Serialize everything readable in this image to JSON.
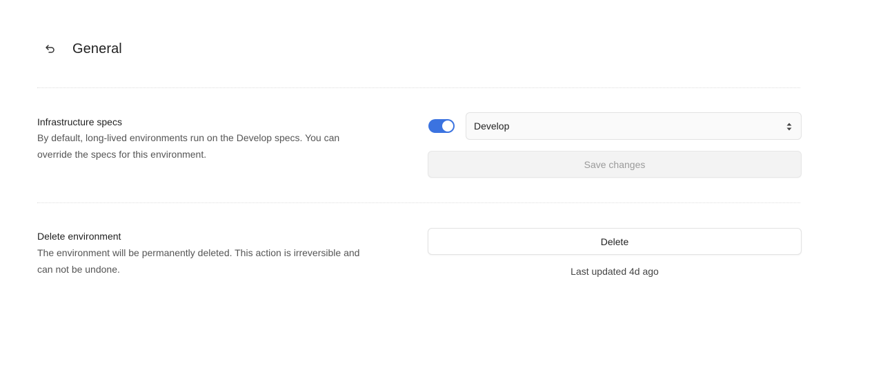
{
  "header": {
    "title": "General",
    "back_icon": "undo-arrow-icon"
  },
  "infrastructure": {
    "title": "Infrastructure specs",
    "description_line1": "By default, long-lived environments run on the Develop specs. You can",
    "description_line2": "override the specs for this environment.",
    "toggle_on": true,
    "select_value": "Develop",
    "save_label": "Save changes"
  },
  "delete_env": {
    "title": "Delete environment",
    "description_line1": "The environment will be permanently deleted. This action is irreversible and",
    "description_line2": "can not be undone.",
    "delete_label": "Delete",
    "last_updated": "Last updated 4d ago"
  },
  "colors": {
    "toggle_active": "#3b73e0",
    "disabled_text": "#9a9a9a"
  }
}
